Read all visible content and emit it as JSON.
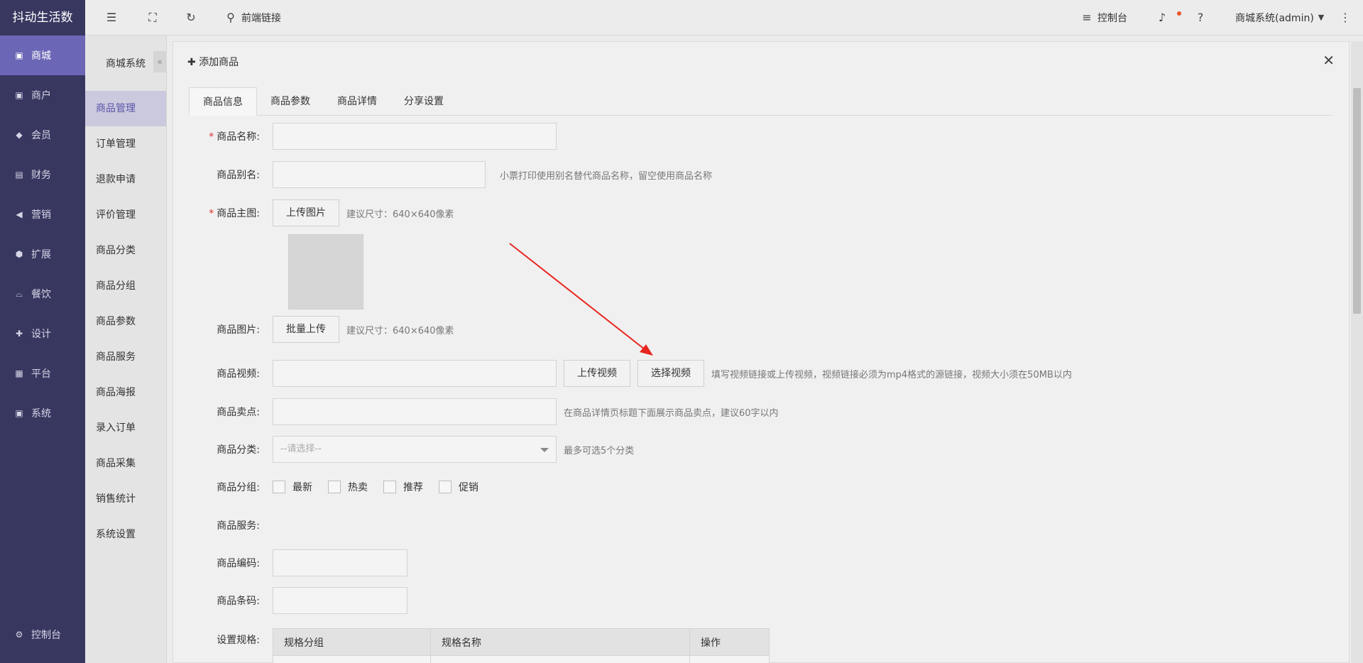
{
  "brand": "抖动生活数",
  "sidebar_main": {
    "items": [
      {
        "label": "商城",
        "icon": "shop-icon",
        "glyph": "▣"
      },
      {
        "label": "商户",
        "icon": "merchant-icon",
        "glyph": "▣"
      },
      {
        "label": "会员",
        "icon": "member-icon",
        "glyph": "◆"
      },
      {
        "label": "财务",
        "icon": "finance-icon",
        "glyph": "▤"
      },
      {
        "label": "营销",
        "icon": "megaphone-icon",
        "glyph": "◀"
      },
      {
        "label": "扩展",
        "icon": "cube-icon",
        "glyph": "⬢"
      },
      {
        "label": "餐饮",
        "icon": "dining-icon",
        "glyph": "⌓"
      },
      {
        "label": "设计",
        "icon": "puzzle-icon",
        "glyph": "✚"
      },
      {
        "label": "平台",
        "icon": "grid-icon",
        "glyph": "▦"
      },
      {
        "label": "系统",
        "icon": "monitor-icon",
        "glyph": "▣"
      }
    ],
    "bottom": {
      "label": "控制台",
      "icon": "gear-icon",
      "glyph": "⚙"
    }
  },
  "sidebar_sub": {
    "title": "商城系统",
    "collapse_glyph": "«",
    "items": [
      "商品管理",
      "订单管理",
      "退款申请",
      "评价管理",
      "商品分类",
      "商品分组",
      "商品参数",
      "商品服务",
      "商品海报",
      "录入订单",
      "商品采集",
      "销售统计",
      "系统设置"
    ]
  },
  "topbar": {
    "frontend_link": "前端链接",
    "console": "控制台",
    "user": "商城系统(admin)"
  },
  "panel": {
    "title": "添加商品",
    "close": "✕",
    "tabs": [
      "商品信息",
      "商品参数",
      "商品详情",
      "分享设置"
    ]
  },
  "form": {
    "name_label": "商品名称:",
    "alias_label": "商品别名:",
    "alias_hint": "小票打印使用别名替代商品名称，留空使用商品名称",
    "main_img_label": "商品主图:",
    "upload_image_btn": "上传图片",
    "size_hint": "建议尺寸：640×640像素",
    "gallery_label": "商品图片:",
    "batch_upload_btn": "批量上传",
    "video_label": "商品视频:",
    "upload_video_btn": "上传视频",
    "select_video_btn": "选择视频",
    "video_hint": "填写视频链接或上传视频，视频链接必须为mp4格式的源链接，视频大小须在50MB以内",
    "selling_label": "商品卖点:",
    "selling_hint": "在商品详情页标题下面展示商品卖点，建议60字以内",
    "category_label": "商品分类:",
    "category_placeholder": "--请选择--",
    "category_hint": "最多可选5个分类",
    "group_label": "商品分组:",
    "groups": [
      "最新",
      "热卖",
      "推荐",
      "促销"
    ],
    "service_label": "商品服务:",
    "code_label": "商品编码:",
    "barcode_label": "商品条码:",
    "spec_label": "设置规格:",
    "spec_headers": [
      "规格分组",
      "规格名称",
      "操作"
    ]
  },
  "colors": {
    "sidebar": "#383760",
    "active": "#6b66b5",
    "arrow": "#e8251f"
  }
}
